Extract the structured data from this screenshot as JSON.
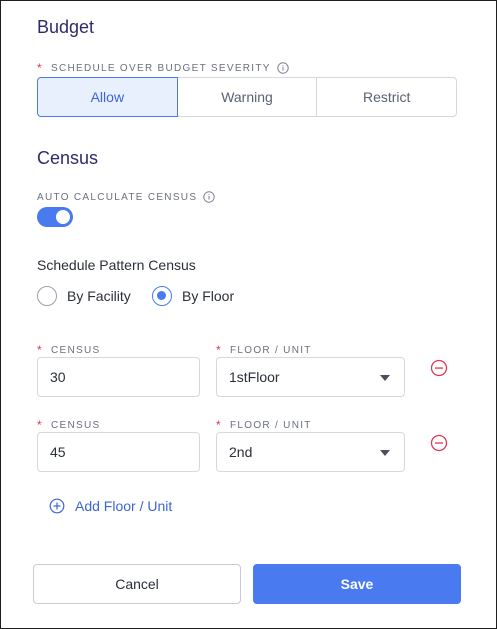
{
  "budget": {
    "title": "Budget",
    "severity_label": "SCHEDULE OVER BUDGET SEVERITY",
    "options": [
      "Allow",
      "Warning",
      "Restrict"
    ],
    "selected": "Allow"
  },
  "census": {
    "title": "Census",
    "auto_label": "AUTO CALCULATE CENSUS",
    "auto_enabled": true,
    "pattern_label": "Schedule Pattern Census",
    "pattern_options": [
      "By Facility",
      "By Floor"
    ],
    "pattern_selected": "By Floor",
    "rows": [
      {
        "census_label": "CENSUS",
        "census_value": "30",
        "floor_label": "FLOOR / UNIT",
        "floor_value": "1stFloor"
      },
      {
        "census_label": "CENSUS",
        "census_value": "45",
        "floor_label": "FLOOR / UNIT",
        "floor_value": "2nd"
      }
    ],
    "add_label": "Add Floor / Unit"
  },
  "footer": {
    "cancel_label": "Cancel",
    "save_label": "Save"
  },
  "colors": {
    "accent": "#4a7af0",
    "required": "#e0364f",
    "heading": "#2e2a6e",
    "remove": "#e0364f"
  }
}
